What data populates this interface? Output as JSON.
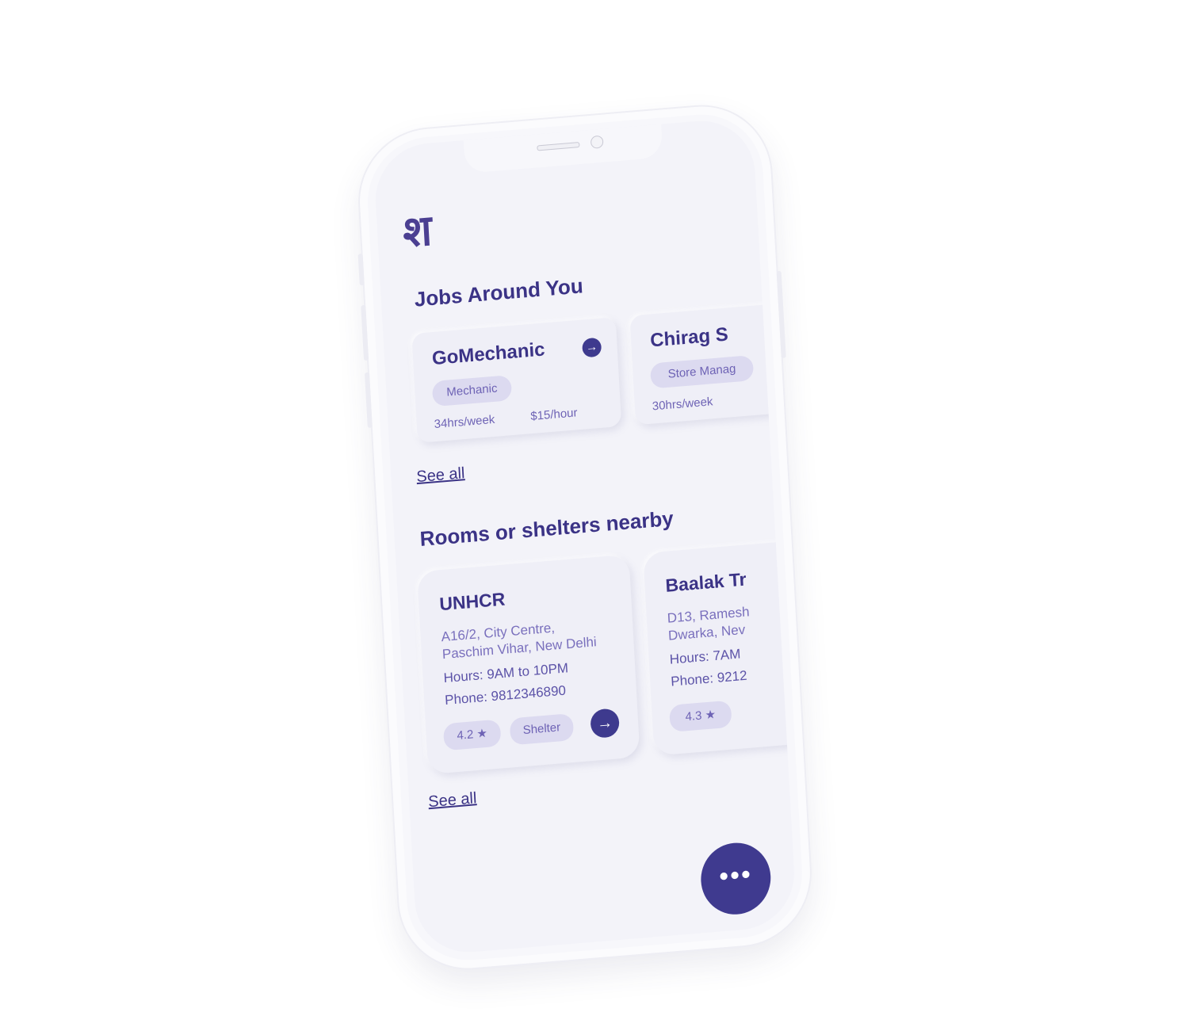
{
  "app": {
    "logo_text": "श"
  },
  "jobs": {
    "title": "Jobs Around You",
    "items": [
      {
        "name": "GoMechanic",
        "role": "Mechanic",
        "hours": "34hrs/week",
        "pay": "$15/hour"
      },
      {
        "name": "Chirag S",
        "role": "Store Manag",
        "hours": "30hrs/week",
        "pay": ""
      }
    ],
    "see_all": "See all"
  },
  "shelters": {
    "title": "Rooms or shelters nearby",
    "items": [
      {
        "name": "UNHCR",
        "address_1": "A16/2, City Centre,",
        "address_2": "Paschim Vihar, New Delhi",
        "hours": "Hours:  9AM to 10PM",
        "phone": "Phone: 9812346890",
        "rating": "4.2",
        "tag": "Shelter"
      },
      {
        "name": "Baalak Tr",
        "address_1": "D13, Ramesh",
        "address_2": "Dwarka, Nev",
        "hours": "Hours:  7AM",
        "phone": "Phone: 9212",
        "rating": "4.3",
        "tag": ""
      }
    ],
    "see_all": "See all"
  },
  "fab": {
    "label": "•••"
  },
  "icons": {
    "arrow": "arrow-right-icon",
    "star": "star-icon",
    "more": "more-icon"
  },
  "colors": {
    "accent": "#3e3a8e",
    "background": "#f3f3f9",
    "chip": "#dcdaf0"
  }
}
